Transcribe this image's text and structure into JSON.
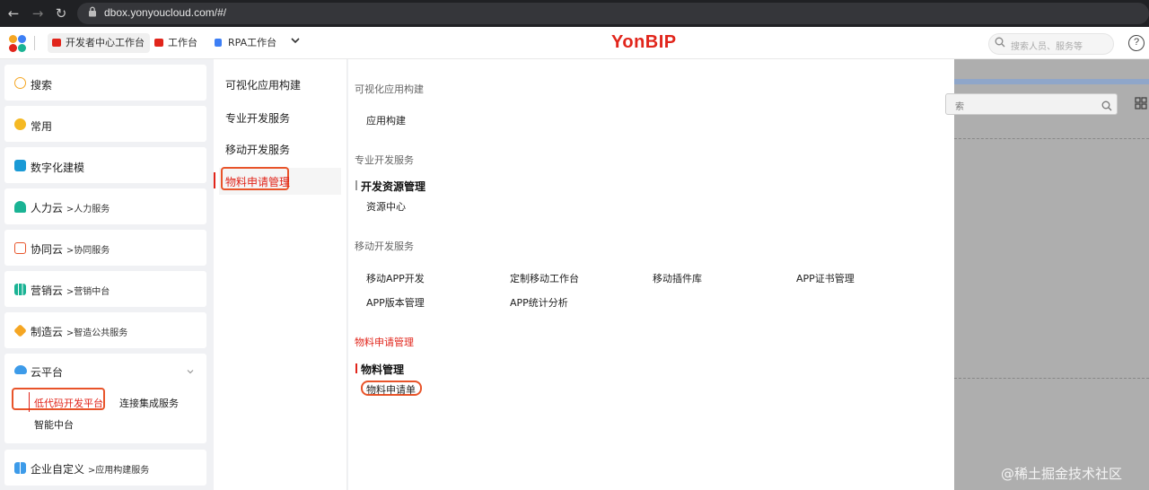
{
  "browser": {
    "url": "dbox.yonyoucloud.com/#/",
    "back": "←",
    "forward": "→",
    "reload": "↻",
    "lock": "🔒"
  },
  "appbar": {
    "tabs": [
      {
        "label": "开发者中心工作台",
        "color": "#e1251b"
      },
      {
        "label": "工作台",
        "color": "#e1251b"
      },
      {
        "label": "RPA工作台",
        "color": "#3d7ff5"
      }
    ],
    "more": "⌄",
    "brand": "YonBIP",
    "search_placeholder": "搜索人员、服务等",
    "search_icon": "⌕",
    "help": "?"
  },
  "sidebar": {
    "search": "搜索",
    "frequent": "常用",
    "digital_modeling": "数字化建模",
    "items": [
      {
        "label": "人力云",
        "sub": "人力服务"
      },
      {
        "label": "协同云",
        "sub": "协同服务"
      },
      {
        "label": "营销云",
        "sub": "营销中台"
      },
      {
        "label": "制造云",
        "sub": "智造公共服务"
      }
    ],
    "cloud_platform": "云平台",
    "expand": "⌄",
    "cloud_subs": [
      "低代码开发平台",
      "连接集成服务",
      "智能中台"
    ],
    "enterprise": {
      "label": "企业自定义",
      "sub": "应用构建服务"
    },
    "arrow": ">"
  },
  "col2": {
    "items": [
      "可视化应用构建",
      "专业开发服务",
      "移动开发服务",
      "物料申请管理"
    ]
  },
  "col3": {
    "s1": {
      "title": "可视化应用构建",
      "link": "应用构建"
    },
    "s2": {
      "title": "专业开发服务",
      "group": "开发资源管理",
      "link": "资源中心"
    },
    "s3": {
      "title": "移动开发服务",
      "links": [
        "移动APP开发",
        "定制移动工作台",
        "移动插件库",
        "APP证书管理",
        "APP版本管理",
        "APP统计分析"
      ]
    },
    "s4": {
      "title": "物料申请管理",
      "group": "物料管理",
      "link": "物料申请单"
    }
  },
  "right": {
    "search_text": "索",
    "search_icon": "⌕",
    "grid_icon": "⊞"
  },
  "watermark": "@稀土掘金技术社区",
  "colors": {
    "accent": "#e1251b",
    "highlight_border": "#e8542a"
  }
}
